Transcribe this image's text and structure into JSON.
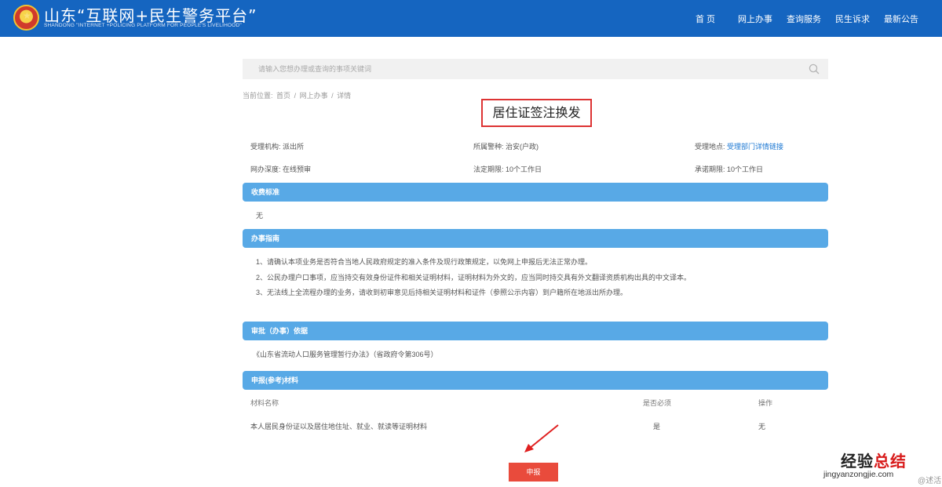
{
  "header": {
    "title": "山东“互联网+民生警务平台”",
    "subtitle": "SHANDONG \"INTERNET +POLICING PLATFORM FOR PEOPLE'S LIVELIHOOD\"",
    "nav": [
      "首 页",
      "网上办事",
      "查询服务",
      "民生诉求",
      "最新公告"
    ]
  },
  "search": {
    "placeholder": "请输入您想办理或查询的事项关键词"
  },
  "breadcrumb": {
    "prefix": "当前位置:",
    "items": [
      "首页",
      "网上办事",
      "详情"
    ],
    "sep": "/"
  },
  "service": {
    "title": "居住证签注换发",
    "info": {
      "agency_label": "受理机构:",
      "agency": "派出所",
      "police_label": "所属警种:",
      "police": "治安(户政)",
      "location_label": "受理地点:",
      "location": "受理部门详情链接",
      "process_label": "网办深度:",
      "process": "在线预审",
      "legal_label": "法定期限:",
      "legal": "10个工作日",
      "promise_label": "承诺期限:",
      "promise": "10个工作日"
    }
  },
  "sections": {
    "fees": {
      "title": "收费标准",
      "content": "无"
    },
    "guide": {
      "title": "办事指南",
      "items": [
        "1、请确认本项业务是否符合当地人民政府规定的准入条件及现行政策规定，以免网上申报后无法正常办理。",
        "2、公民办理户口事项，应当持交有效身份证件和相关证明材料，证明材料为外文的，应当同时持交具有外文翻译资质机构出具的中文译本。",
        "3、无法线上全流程办理的业务，请收到初审意见后持相关证明材料和证件（参照公示内容）到户籍所在地派出所办理。"
      ]
    },
    "basis": {
      "title": "审批（办事）依据",
      "content": "《山东省流动人口服务管理暂行办法》（省政府令第306号）"
    },
    "materials": {
      "title": "申报(参考)材料",
      "headers": [
        "材料名称",
        "是否必须",
        "操作"
      ],
      "rows": [
        {
          "name": "本人居民身份证以及居住地住址、就业、就读等证明材料",
          "required": "是",
          "action": "无"
        }
      ]
    }
  },
  "apply_button": "申报",
  "watermark": {
    "main_a": "经验",
    "main_b": "总结",
    "sub": "jingyanzongjie.com",
    "corner": "@述活"
  }
}
